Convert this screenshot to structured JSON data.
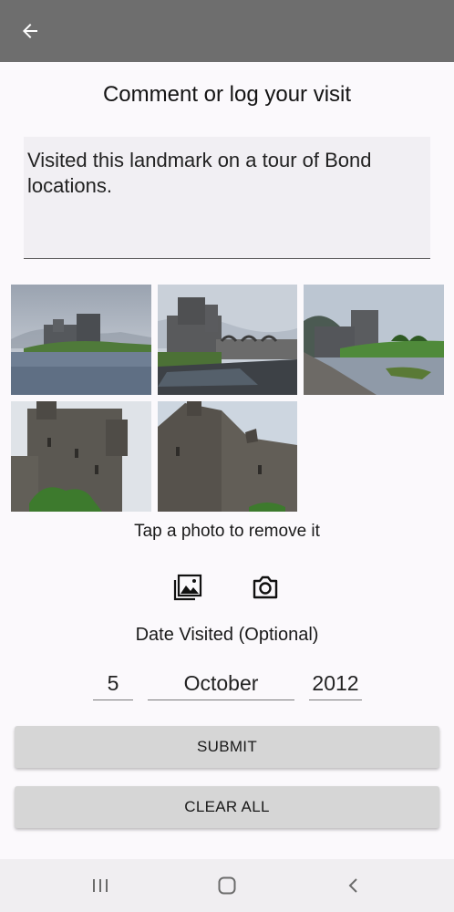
{
  "header": {
    "back_icon": "arrow-left-icon"
  },
  "page": {
    "title": "Comment or log your visit"
  },
  "comment": {
    "value": "Visited this landmark on a tour of Bond locations."
  },
  "photos": {
    "hint": "Tap a photo to remove it",
    "count": 5
  },
  "actions": {
    "gallery_icon": "image-gallery-icon",
    "camera_icon": "camera-icon"
  },
  "date": {
    "label": "Date Visited (Optional)",
    "day": "5",
    "month": "October",
    "year": "2012"
  },
  "buttons": {
    "submit": "SUBMIT",
    "clear_all": "CLEAR ALL"
  },
  "system_nav": {
    "recents_icon": "recents-icon",
    "home_icon": "home-icon",
    "back_icon": "back-chevron-icon"
  },
  "colors": {
    "app_bar": "#6e6e6e",
    "button_bg": "#d6d6d6",
    "page_bg": "#fbf9fc"
  }
}
